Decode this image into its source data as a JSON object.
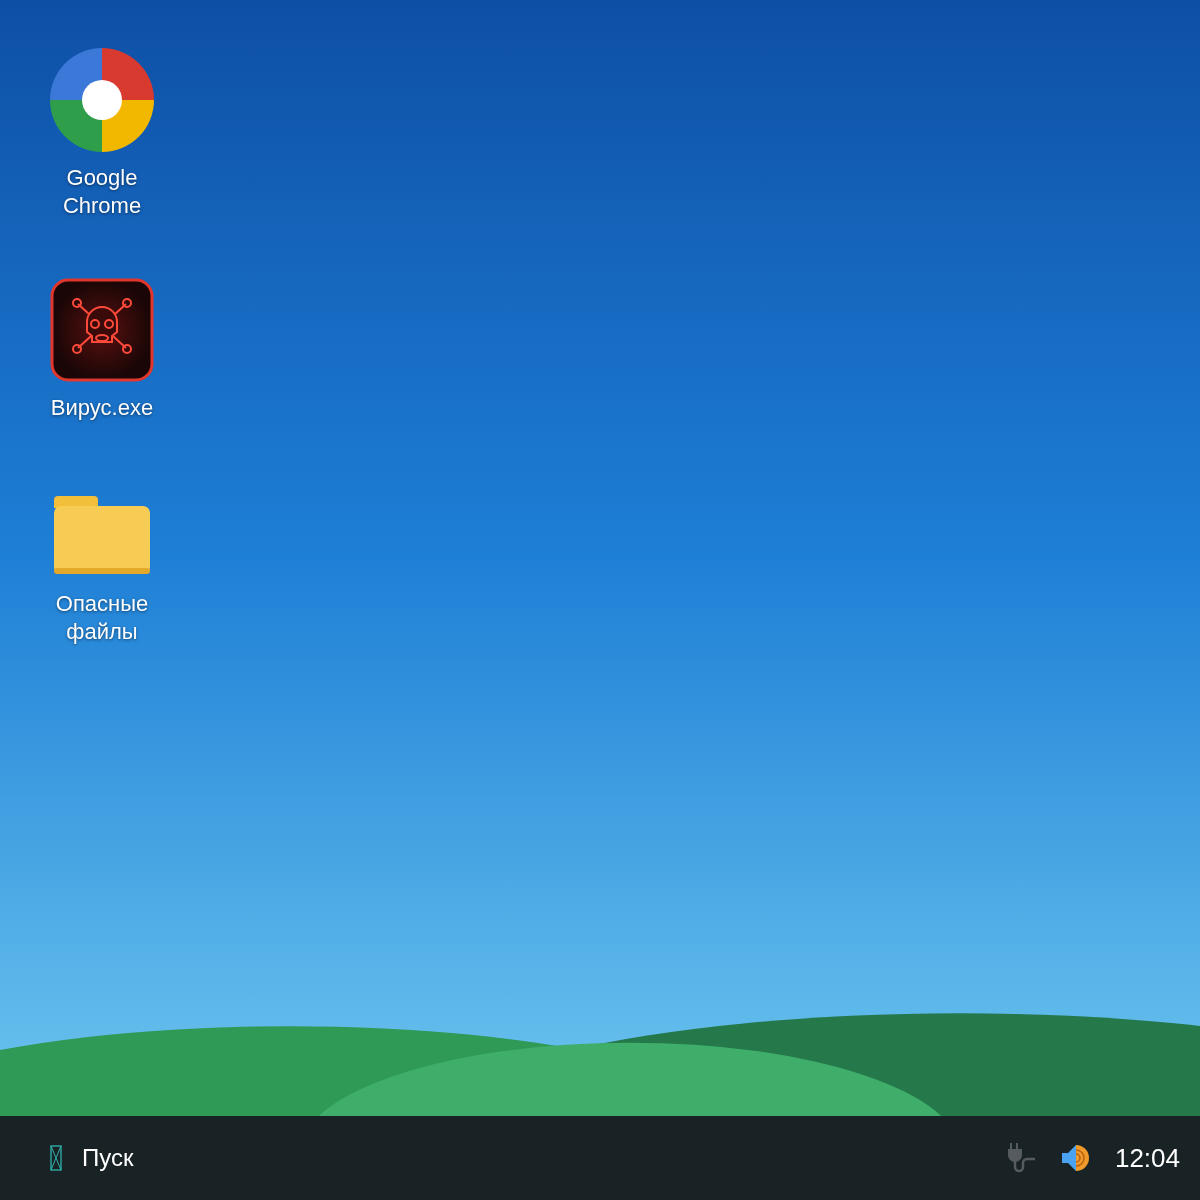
{
  "desktop_icons": [
    {
      "kind": "browser",
      "label": "Google Chrome"
    },
    {
      "kind": "virus",
      "label": "Вирус.exe"
    },
    {
      "kind": "folder",
      "label": "Опасные файлы"
    }
  ],
  "taskbar": {
    "start_button": {
      "label": "Пуск"
    },
    "clock": "12:04"
  }
}
